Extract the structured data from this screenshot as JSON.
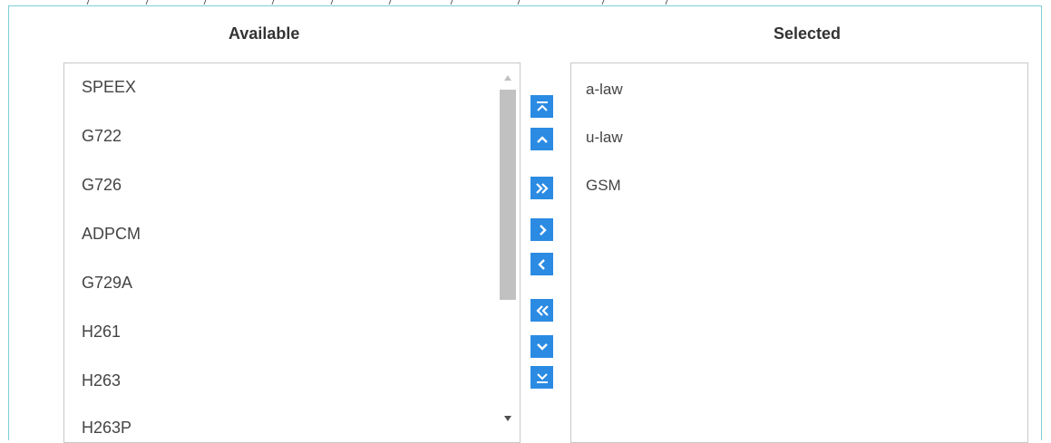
{
  "available_header": "Available",
  "selected_header": "Selected",
  "available_items": [
    "SPEEX",
    "G722",
    "G726",
    "ADPCM",
    "G729A",
    "H261",
    "H263",
    "H263P"
  ],
  "selected_items": [
    "a-law",
    "u-law",
    "GSM"
  ],
  "buttons": [
    {
      "name": "move-to-top-button",
      "icon": "chevron-up-to-bar-icon"
    },
    {
      "name": "move-up-button",
      "icon": "chevron-up-icon"
    },
    {
      "name": "add-all-button",
      "icon": "double-chevron-right-icon"
    },
    {
      "name": "add-button",
      "icon": "chevron-right-icon"
    },
    {
      "name": "remove-button",
      "icon": "chevron-left-icon"
    },
    {
      "name": "remove-all-button",
      "icon": "double-chevron-left-icon"
    },
    {
      "name": "move-down-button",
      "icon": "chevron-down-icon"
    },
    {
      "name": "move-to-bottom-button",
      "icon": "chevron-down-to-bar-icon"
    }
  ],
  "colors": {
    "accent": "#2b8be3",
    "frame_border": "#7ccfd6"
  }
}
